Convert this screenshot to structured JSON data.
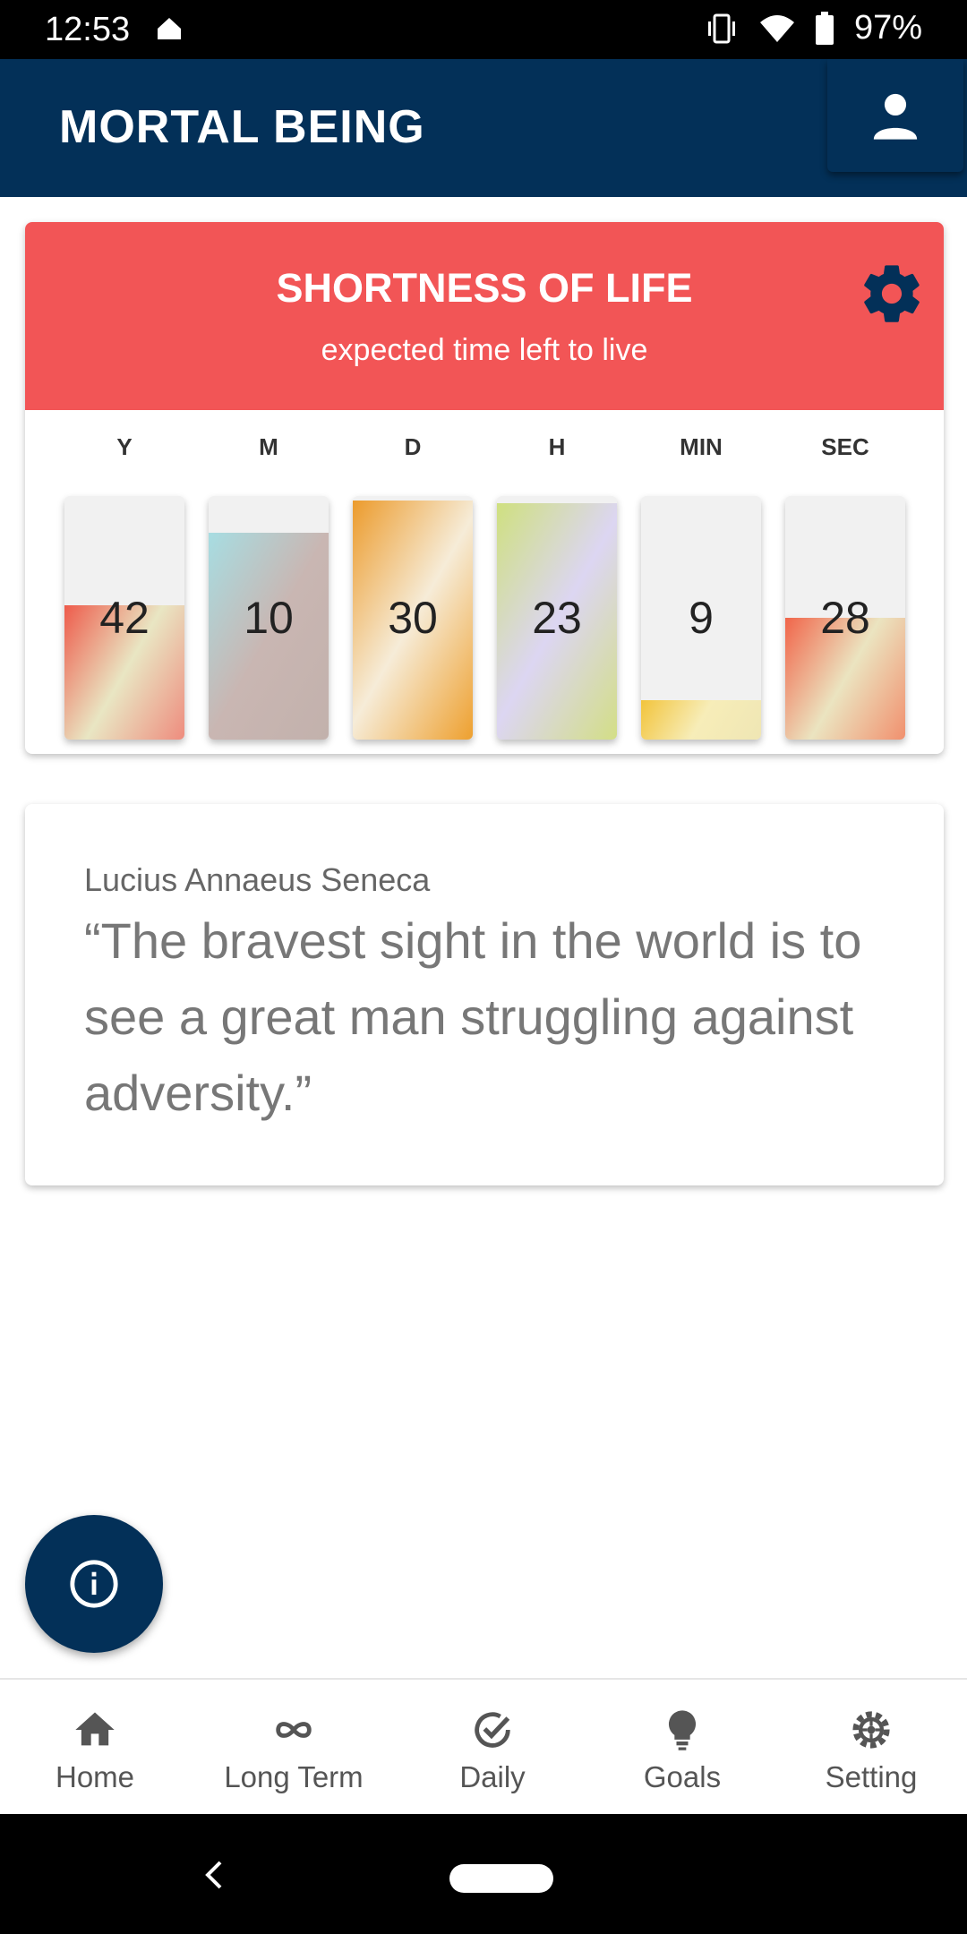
{
  "status_bar": {
    "time": "12:53",
    "battery": "97%"
  },
  "app_bar": {
    "title": "MORTAL BEING"
  },
  "countdown": {
    "title": "SHORTNESS OF LIFE",
    "subtitle": "expected time left to live",
    "units": [
      {
        "label": "Y",
        "value": "42",
        "fill_fraction": 0.55,
        "gradient": [
          "#ee5b4b",
          "#e9e6c3",
          "#ee8c7e"
        ]
      },
      {
        "label": "M",
        "value": "10",
        "fill_fraction": 0.85,
        "gradient": [
          "#a7dde2",
          "#c9b6b2",
          "#c2b1ac"
        ]
      },
      {
        "label": "D",
        "value": "30",
        "fill_fraction": 0.98,
        "gradient": [
          "#ec9b2c",
          "#f6ecd8",
          "#eea02f"
        ]
      },
      {
        "label": "H",
        "value": "23",
        "fill_fraction": 0.97,
        "gradient": [
          "#cfe07f",
          "#dcd6f2",
          "#d3de86"
        ]
      },
      {
        "label": "MIN",
        "value": "9",
        "fill_fraction": 0.16,
        "gradient": [
          "#f2c43c",
          "#f7edb8",
          "#efe6b4"
        ]
      },
      {
        "label": "SEC",
        "value": "28",
        "fill_fraction": 0.5,
        "gradient": [
          "#f1654a",
          "#ebe4c0",
          "#f1906e"
        ]
      }
    ]
  },
  "quote": {
    "author": "Lucius Annaeus Seneca",
    "text": "“The bravest sight in the world is to see a great man struggling against adversity.”"
  },
  "bottom_nav": {
    "items": [
      {
        "label": "Home",
        "icon": "home-icon"
      },
      {
        "label": "Long Term",
        "icon": "infinity-icon"
      },
      {
        "label": "Daily",
        "icon": "check-circle-icon"
      },
      {
        "label": "Goals",
        "icon": "lightbulb-icon"
      },
      {
        "label": "Setting",
        "icon": "gear-icon"
      }
    ]
  },
  "colors": {
    "primary": "#033058",
    "accent_red": "#f25556"
  }
}
